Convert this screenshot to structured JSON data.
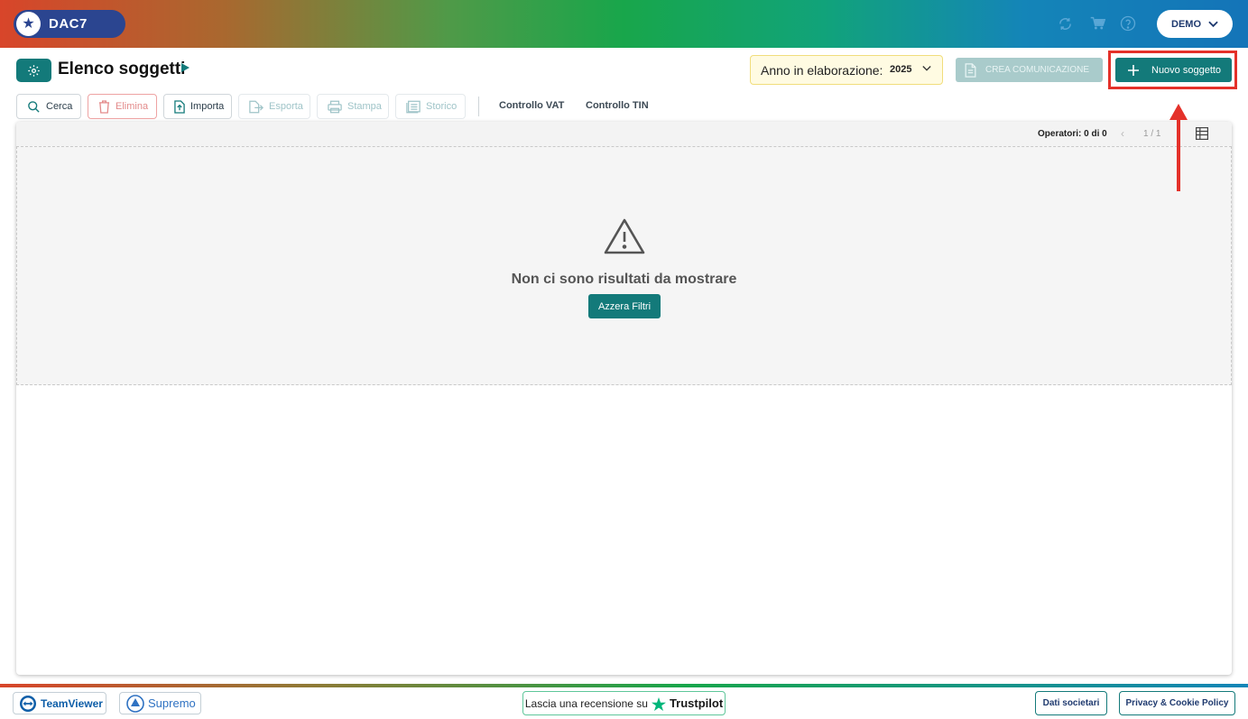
{
  "header": {
    "logo_text": "DAC7",
    "user_menu_label": "DEMO",
    "icons": [
      "refresh-icon",
      "cart-icon",
      "help-icon"
    ]
  },
  "title_row": {
    "page_title": "Elenco soggetti",
    "year_label": "Anno in elaborazione:",
    "year_value": "2025",
    "crea_label": "CREA COMUNICAZIONE",
    "nuovo_label": "Nuovo soggetto"
  },
  "toolbar": {
    "cerca": "Cerca",
    "elimina": "Elimina",
    "importa": "Importa",
    "esporta": "Esporta",
    "stampa": "Stampa",
    "storico": "Storico",
    "controllo_vat": "Controllo VAT",
    "controllo_tin": "Controllo TIN"
  },
  "table": {
    "operatori_label": "Operatori: 0 di 0",
    "pagination": "1 / 1",
    "empty_message": "Non ci sono risultati da mostrare",
    "reset_filters_label": "Azzera Filtri"
  },
  "footer": {
    "teamviewer_label": "TeamViewer",
    "supremo_label": "Supremo",
    "review_prefix": "Lascia una recensione su",
    "review_brand": "Trustpilot",
    "dati_societari": "Dati societari",
    "privacy": "Privacy & Cookie Policy"
  },
  "colors": {
    "accent": "#137a7a",
    "highlight": "#e4312a",
    "logo_bg": "#2b4590"
  }
}
